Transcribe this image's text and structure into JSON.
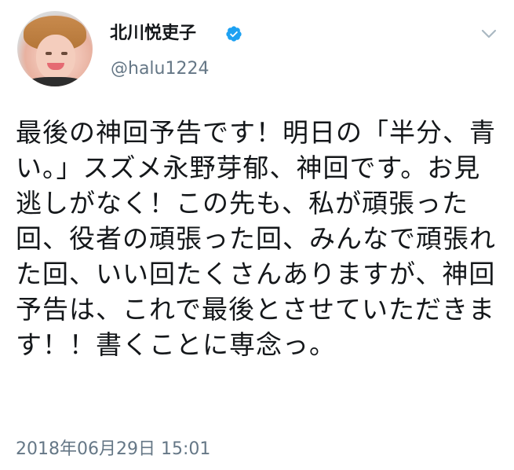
{
  "user": {
    "display_name": "北川悦吏子",
    "handle": "@halu1224",
    "verified": true,
    "avatar_icon": "profile-photo-icon"
  },
  "menu": {
    "icon": "chevron-down-icon"
  },
  "tweet": {
    "text": "最後の神回予告です！明日の「半分、青い。」スズメ永野芽郁、神回です。お見逃しがなく！この先も、私が頑張った回、役者の頑張った回、みんなで頑張れた回、いい回たくさんありますが、神回予告は、これで最後とさせていただきます！！書くことに専念っ。",
    "timestamp": "2018年06月29日 15:01"
  },
  "colors": {
    "text_primary": "#14171a",
    "text_secondary": "#657786",
    "verified_blue": "#1da1f2",
    "chevron": "#aab8c2"
  }
}
